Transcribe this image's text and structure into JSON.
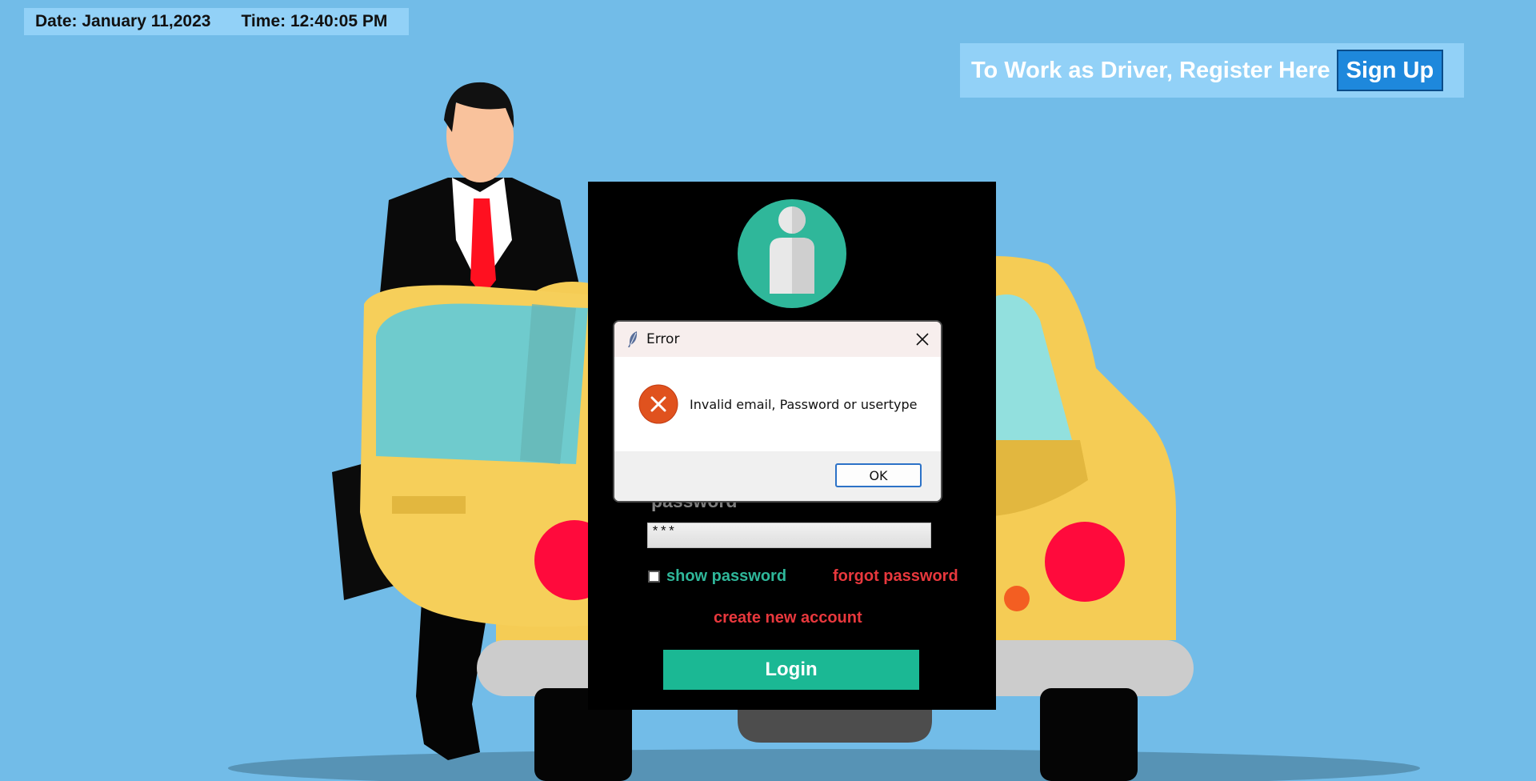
{
  "header": {
    "date_text": "Date: January 11,2023",
    "time_text": "Time: 12:40:05 PM"
  },
  "register": {
    "prompt": "To Work as Driver, Register Here",
    "signup_label": "Sign Up"
  },
  "login": {
    "password_label": "password",
    "password_value": "***",
    "show_password_label": "show password",
    "show_password_checked": false,
    "forgot_password_label": "forgot password",
    "create_account_label": "create new account",
    "login_label": "Login"
  },
  "dialog": {
    "title": "Error",
    "message": "Invalid email, Password or usertype",
    "ok_label": "OK",
    "icon": "error-icon"
  },
  "colors": {
    "background": "#72bce8",
    "accent_green": "#1bb894",
    "link_red": "#e8383d",
    "signup_blue": "#1e88dc"
  }
}
